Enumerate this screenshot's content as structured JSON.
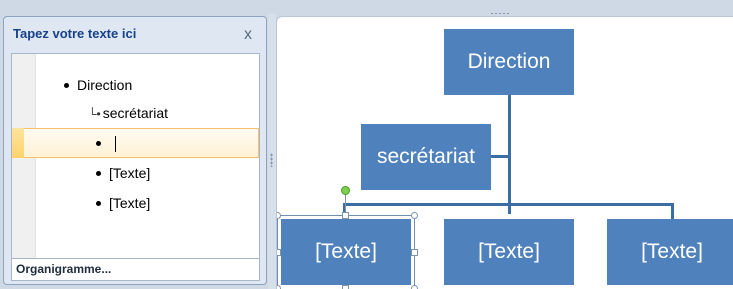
{
  "text_pane": {
    "title": "Tapez votre texte ici",
    "close_glyph": "x",
    "items": [
      {
        "level": 1,
        "text": "Direction"
      },
      {
        "level": 2,
        "text": "secrétariat"
      },
      {
        "level": 1,
        "text": ""
      },
      {
        "level": 1,
        "text": "[Texte]"
      },
      {
        "level": 1,
        "text": "[Texte]"
      }
    ],
    "footer": "Organigramme..."
  },
  "diagram": {
    "nodes": {
      "top": "Direction",
      "assistant": "secrétariat",
      "child1": "[Texte]",
      "child2": "[Texte]",
      "child3": "[Texte]"
    },
    "box_color": "#4f81bd",
    "line_color": "#3a6ea5",
    "text_color": "#ffffff"
  }
}
